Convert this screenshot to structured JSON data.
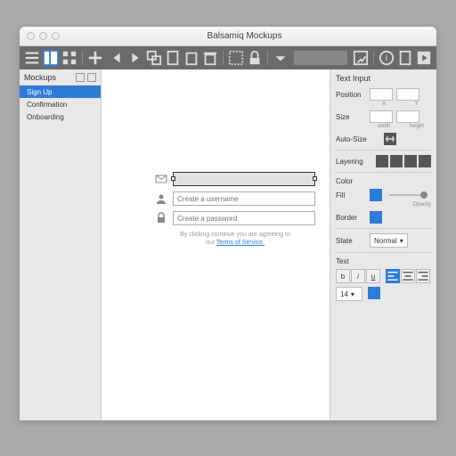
{
  "window": {
    "title": "Balsamiq Mockups"
  },
  "sidebar": {
    "header": "Mockups",
    "items": [
      "Sign Up",
      "Confirmation",
      "Onboarding"
    ],
    "selected": 0
  },
  "mockup": {
    "email_placeholder": "",
    "username_placeholder": "Create a username",
    "password_placeholder": "Create a password",
    "terms_line1": "By clicking continue you are agreeing to",
    "terms_prefix": "our ",
    "terms_link": "Terms of Service."
  },
  "inspector": {
    "title": "Text Input",
    "position_label": "Position",
    "size_label": "Size",
    "x_label": "X",
    "y_label": "Y",
    "w_label": "width",
    "h_label": "height",
    "autosize_label": "Auto-Size",
    "layering_label": "Layering",
    "color_label": "Color",
    "fill_label": "Fill",
    "border_label": "Border",
    "opacity_label": "Opacity",
    "state_label": "State",
    "state_value": "Normal",
    "text_label": "Text",
    "fontsize_value": "14",
    "fill_color": "#2e7cd6",
    "border_color": "#2e7cd6"
  }
}
